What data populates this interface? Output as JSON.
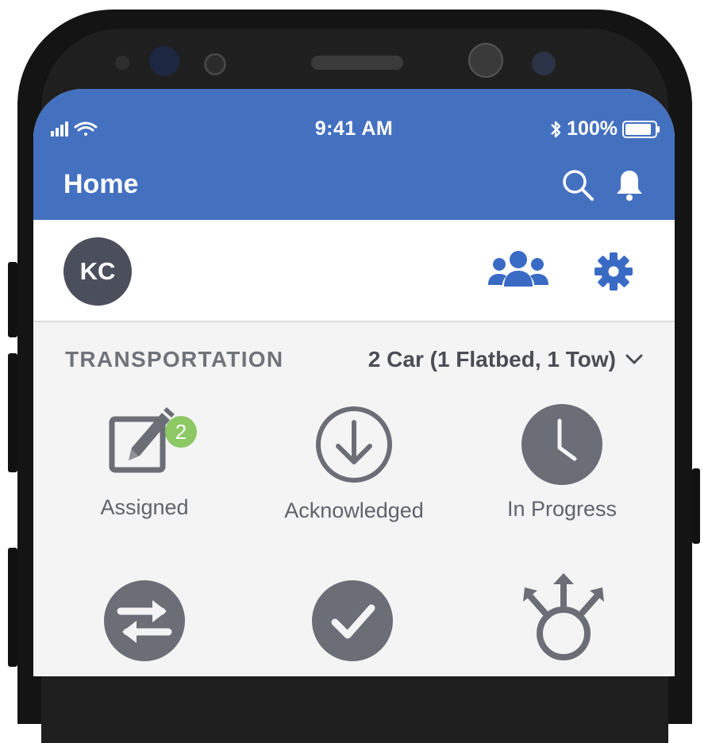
{
  "status_bar": {
    "time": "9:41 AM",
    "battery": "100%",
    "battery_level": 1.0,
    "icons": [
      "cellular-signal-icon",
      "wifi-icon",
      "bluetooth-icon",
      "battery-icon"
    ]
  },
  "header": {
    "title": "Home",
    "actions": [
      "search-icon",
      "bell-icon"
    ]
  },
  "user": {
    "initials": "KC",
    "actions": [
      "team-icon",
      "gear-icon"
    ]
  },
  "section": {
    "title": "TRANSPORTATION",
    "filter_value": "2 Car (1 Flatbed, 1 Tow)",
    "filter_icon": "chevron-down-icon"
  },
  "tiles": [
    {
      "label": "Assigned",
      "icon": "edit-icon",
      "badge": "2"
    },
    {
      "label": "Acknowledged",
      "icon": "download-circle-icon"
    },
    {
      "label": "In Progress",
      "icon": "clock-icon"
    },
    {
      "label": "",
      "icon": "transfer-icon"
    },
    {
      "label": "",
      "icon": "check-circle-icon"
    },
    {
      "label": "",
      "icon": "multi-arrow-icon"
    }
  ],
  "colors": {
    "app_bar": "#4470c0",
    "accent": "#3a6bc4",
    "icon_gray": "#6b6e76",
    "badge": "#8cc864",
    "avatar": "#4b4f5c"
  }
}
